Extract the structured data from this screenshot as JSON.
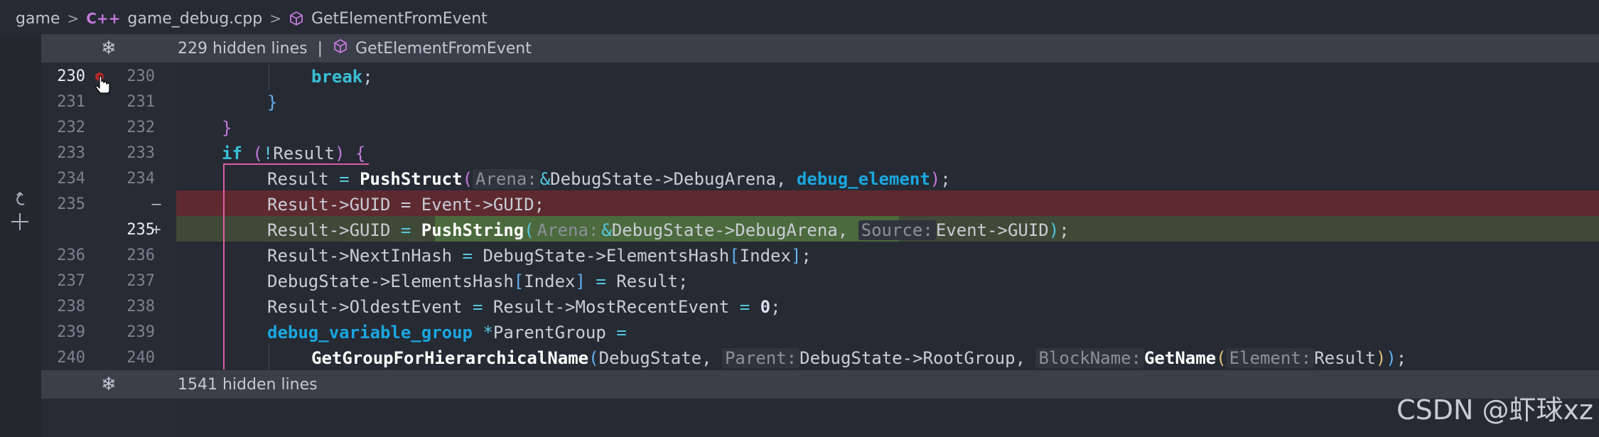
{
  "breadcrumb": {
    "root": "game",
    "file_badge": "C++",
    "file": "game_debug.cpp",
    "symbol": "GetElementFromEvent"
  },
  "hidden_top": {
    "text": "229 hidden lines",
    "separator": "|",
    "symbol": "GetElementFromEvent"
  },
  "hidden_bottom": {
    "text": "1541 hidden lines"
  },
  "lines": [
    {
      "old": "230",
      "new": "230"
    },
    {
      "old": "231",
      "new": "231"
    },
    {
      "old": "232",
      "new": "232"
    },
    {
      "old": "233",
      "new": "233"
    },
    {
      "old": "234",
      "new": "234"
    },
    {
      "old": "235",
      "new": "",
      "marker": "—"
    },
    {
      "old": "",
      "new": "235",
      "marker": "+"
    },
    {
      "old": "236",
      "new": "236"
    },
    {
      "old": "237",
      "new": "237"
    },
    {
      "old": "238",
      "new": "238"
    },
    {
      "old": "239",
      "new": "239"
    },
    {
      "old": "240",
      "new": "240"
    }
  ],
  "code": {
    "l230": {
      "kw": "break",
      "rest": ";"
    },
    "l231": {
      "brace": "}"
    },
    "l232": {
      "brace": "}"
    },
    "l233": {
      "kw": "if",
      "open": "(",
      "bang": "!",
      "var": "Result",
      "close": ")",
      "brace": "{"
    },
    "l234": {
      "lhs": "Result",
      "eq": "=",
      "fn": "PushStruct",
      "open": "(",
      "hint": "Arena:",
      "amp": "&",
      "arg1": "DebugState->DebugArena, ",
      "type": "debug_element",
      "close": ")",
      "end": ";"
    },
    "l235d": {
      "text": "Result->GUID = Event->GUID;"
    },
    "l235a": {
      "lhs": "Result->GUID",
      "eq": "=",
      "fn": "PushString",
      "open": "(",
      "hint1": "Arena:",
      "amp": "&",
      "arg1": "DebugState->DebugArena,",
      "hint2": "Source:",
      "arg2": "Event->GUID",
      "close": ")",
      "end": ";"
    },
    "l236": {
      "lhs": "Result->NextInHash",
      "eq": "=",
      "arr": "DebugState->ElementsHash",
      "ob": "[",
      "idx": "Index",
      "cb": "]",
      "end": ";"
    },
    "l237": {
      "arr": "DebugState->ElementsHash",
      "ob": "[",
      "idx": "Index",
      "cb": "]",
      "eq": "=",
      "rhs": "Result",
      "end": ";"
    },
    "l238": {
      "lhs": "Result->OldestEvent",
      "eq1": "=",
      "mid": "Result->MostRecentEvent",
      "eq2": "=",
      "num": "0",
      "end": ";"
    },
    "l239": {
      "type": "debug_variable_group",
      "star": "*",
      "var": "ParentGroup",
      "eq": "="
    },
    "l240": {
      "fn": "GetGroupForHierarchicalName",
      "open": "(",
      "arg1": "DebugState, ",
      "hint1": "Parent:",
      "arg2": "DebugState->RootGroup, ",
      "hint2": "BlockName:",
      "fn2": "GetName",
      "open2": "(",
      "hint3": "Element:",
      "arg3": "Result",
      "close2": ")",
      "close": ")",
      "end": ";"
    }
  },
  "watermark": "CSDN @虾球xz",
  "colors": {
    "deleted_bg": "#5e2a30",
    "added_bg": "#3e4a37",
    "keyword": "#39c0d6",
    "type": "#1aa7e0",
    "brace": "#c678dd"
  }
}
